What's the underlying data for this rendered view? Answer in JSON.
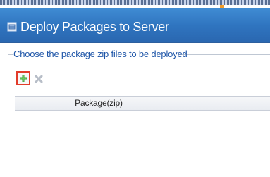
{
  "window": {
    "title": "Deploy Packages to Server",
    "icon": "package-deploy-icon"
  },
  "group": {
    "label": "Choose the package zip files to be deployed"
  },
  "toolbar": {
    "add_icon": "plus-icon",
    "remove_icon": "remove-x-icon"
  },
  "table": {
    "columns": [
      "Package(zip)",
      ""
    ],
    "rows": []
  },
  "colors": {
    "titlebar": "#2f74bf",
    "group_label": "#1f56a8",
    "highlight": "#e23b2a",
    "accent": "#f29c2a"
  }
}
